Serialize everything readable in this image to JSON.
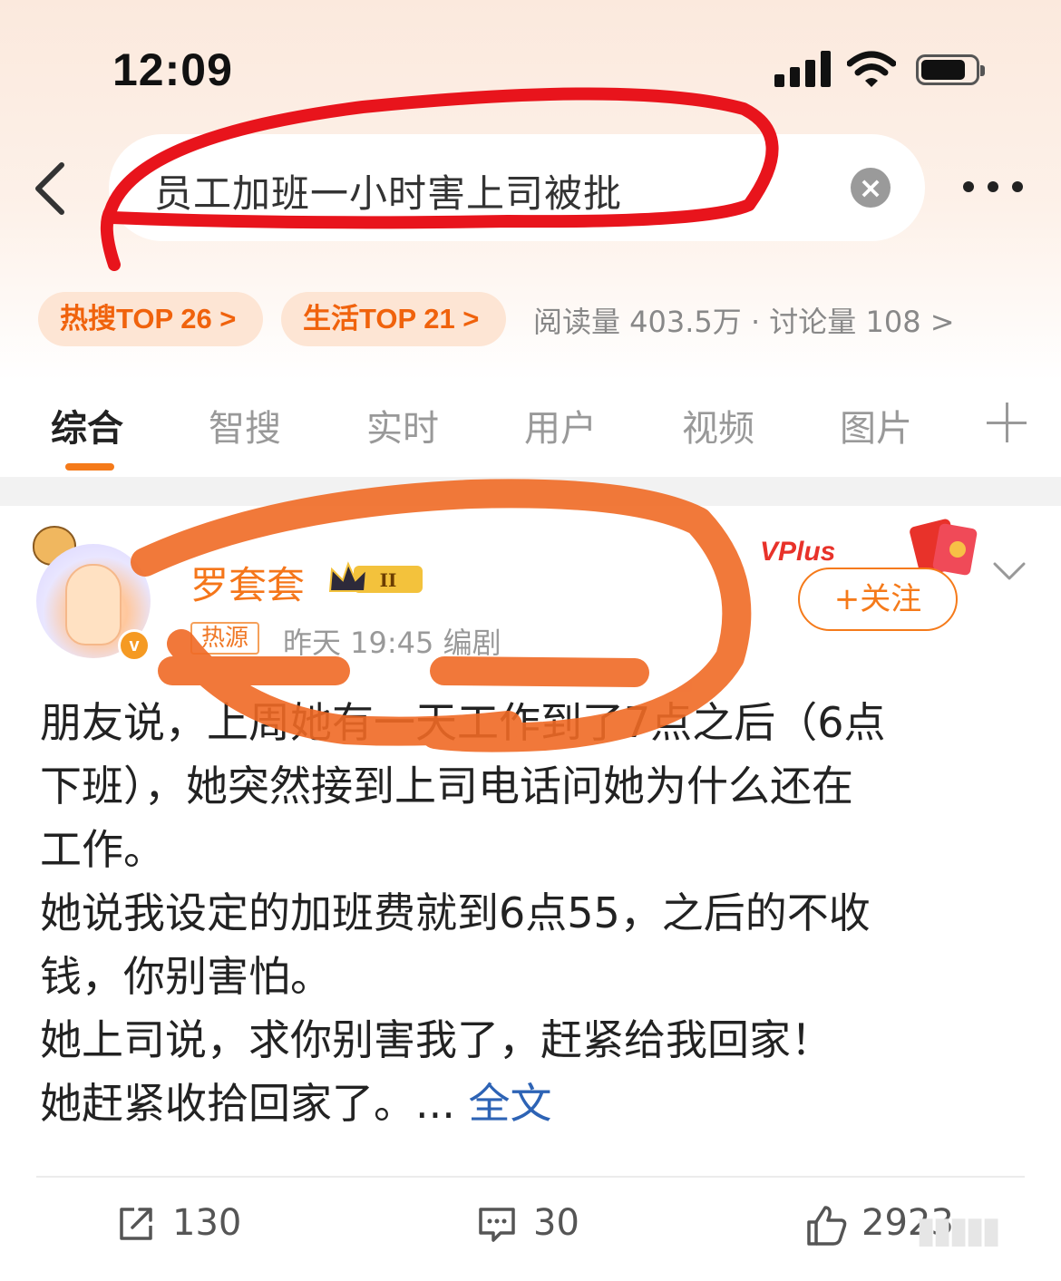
{
  "status_bar": {
    "time": "12:09"
  },
  "search": {
    "query": "员工加班一小时害上司被批"
  },
  "badges": {
    "hot": "热搜TOP 26 >",
    "life": "生活TOP 21 >",
    "stats": "阅读量 403.5万 · 讨论量 108 >"
  },
  "tabs": [
    "综合",
    "智搜",
    "实时",
    "用户",
    "视频",
    "图片"
  ],
  "post": {
    "username": "罗套套",
    "level_badge": "II",
    "hot_tag": "热源",
    "meta": "昨天 19:45  编剧",
    "vplus_label": "VPlus",
    "follow_label": "+关注",
    "avatar_badge": "v",
    "lines": [
      "朋友说，上周她有一天工作到了7点之后（6点",
      "下班），她突然接到上司电话问她为什么还在",
      "工作。",
      "她说我设定的加班费就到6点55，之后的不收",
      "钱，你别害怕。",
      "她上司说，求你别害我了，赶紧给我回家！",
      "她赶紧收拾回家了。... "
    ],
    "full_text_link": "全文",
    "reposts": "130",
    "comments": "30",
    "likes": "2923"
  },
  "colors": {
    "accent": "#f57a1a",
    "link": "#2d63b5",
    "red_annotation": "#e8141c",
    "orange_annotation": "#f06a25"
  }
}
